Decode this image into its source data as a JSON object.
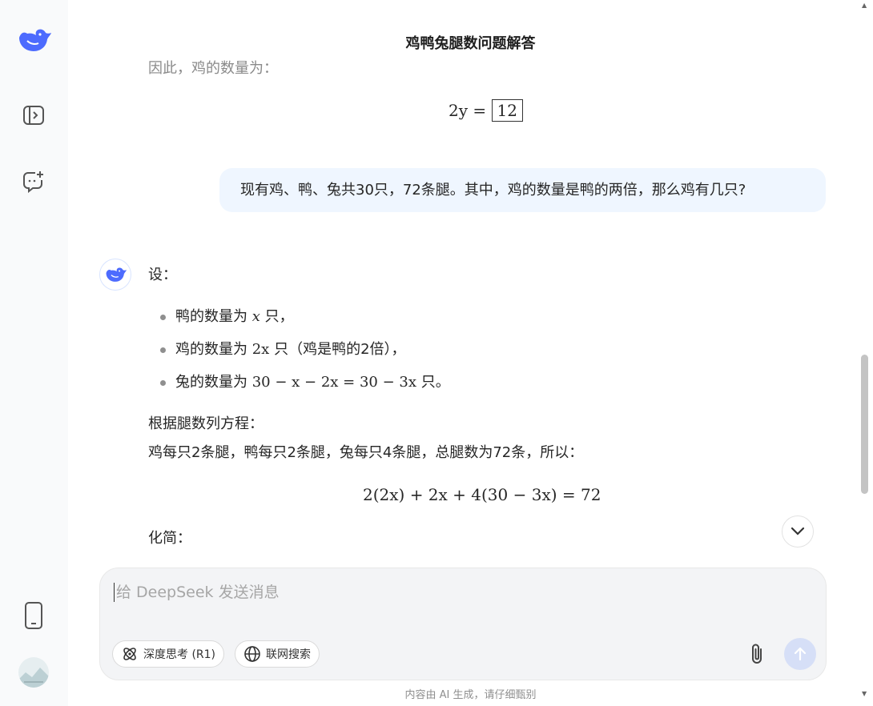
{
  "title": "鸡鸭兔腿数问题解答",
  "sidebar": {
    "icons": [
      "deepseek-logo-icon",
      "expand-sidebar-icon",
      "new-chat-icon",
      "phone-icon",
      "user-avatar"
    ]
  },
  "prev_answer": {
    "text": "因此，鸡的数量为：",
    "eq_left": "2y =",
    "eq_box": "12"
  },
  "user_message": "现有鸡、鸭、兔共30只，72条腿。其中，鸡的数量是鸭的两倍，那么鸡有几只?",
  "answer": {
    "intro": "设：",
    "bullets": [
      {
        "pre": "鸭的数量为 ",
        "math": "x",
        "post": " 只，"
      },
      {
        "pre": "鸡的数量为 ",
        "math": "2x",
        "post": " 只（鸡是鸭的2倍），"
      },
      {
        "pre": "兔的数量为 ",
        "math": "30 − x − 2x = 30 − 3x",
        "post": " 只。"
      }
    ],
    "para1": "根据腿数列方程：",
    "para2": "鸡每只2条腿，鸭每只2条腿，兔每只4条腿，总腿数为72条，所以：",
    "equation": "2(2x) + 2x + 4(30 − 3x) = 72",
    "simplify": "化简："
  },
  "composer": {
    "placeholder": "给 DeepSeek 发送消息",
    "deep_think_label": "深度思考 (R1)",
    "web_search_label": "联网搜索"
  },
  "footer_note": "内容由 AI 生成，请仔细甄别",
  "colors": {
    "accent": "#4d6bfe",
    "bubble": "#eff6ff",
    "sidebar": "#f9fafb"
  }
}
